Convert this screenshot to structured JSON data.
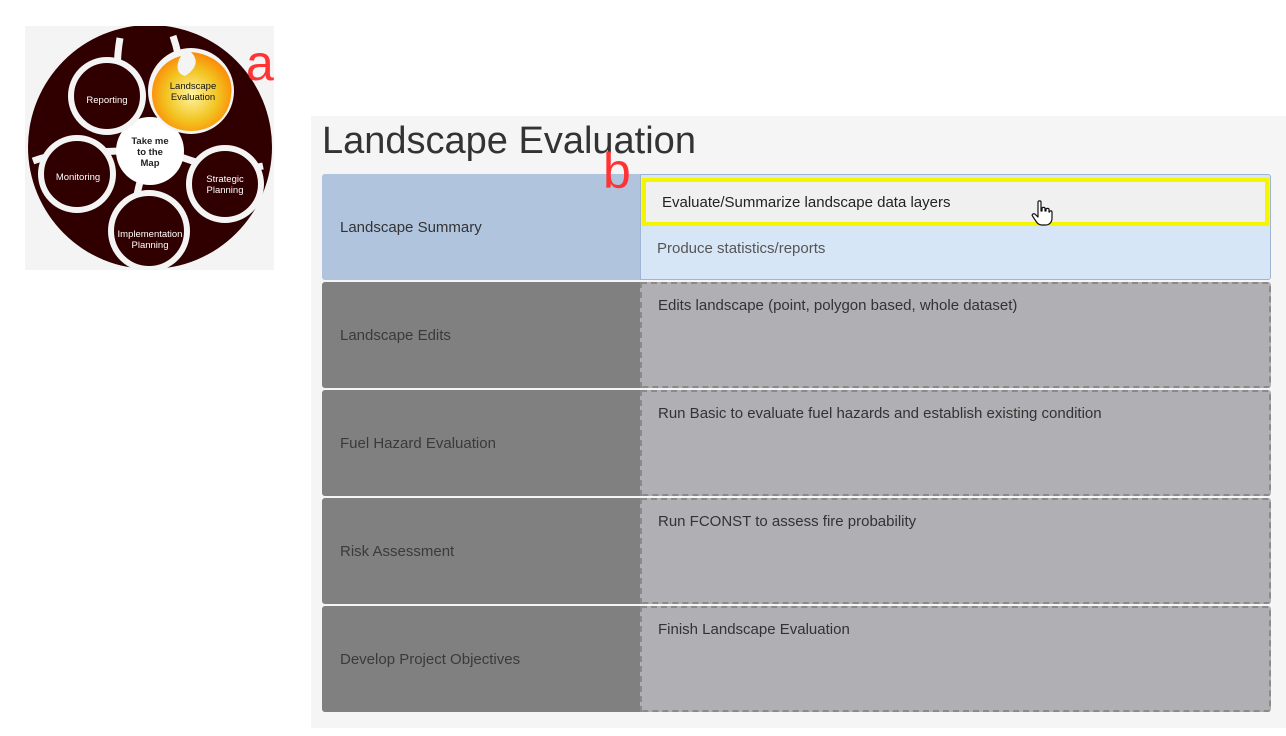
{
  "annotations": {
    "a": "a",
    "b": "b"
  },
  "wheel": {
    "center": "Take me\nto the\nMap",
    "segments": [
      {
        "id": "landscape-evaluation",
        "label": "Landscape\nEvaluation",
        "active": true
      },
      {
        "id": "strategic-planning",
        "label": "Strategic\nPlanning"
      },
      {
        "id": "implementation-planning",
        "label": "Implementation\nPlanning"
      },
      {
        "id": "monitoring",
        "label": "Monitoring"
      },
      {
        "id": "reporting",
        "label": "Reporting"
      }
    ],
    "colors": {
      "disc": "#300000",
      "active_fill": "#f2c320",
      "active_glow": "#ff8a00"
    }
  },
  "page": {
    "title": "Landscape Evaluation",
    "steps": [
      {
        "label": "Landscape Summary",
        "state": "active",
        "tasks": [
          "Evaluate/Summarize landscape data layers",
          "Produce statistics/reports"
        ]
      },
      {
        "label": "Landscape Edits",
        "state": "disabled",
        "tasks": [
          "Edits landscape (point, polygon based, whole dataset)"
        ]
      },
      {
        "label": "Fuel Hazard Evaluation",
        "state": "disabled",
        "tasks": [
          "Run Basic to evaluate fuel hazards and establish existing condition"
        ]
      },
      {
        "label": "Risk Assessment",
        "state": "disabled",
        "tasks": [
          "Run FCONST to assess fire probability"
        ]
      },
      {
        "label": "Develop Project Objectives",
        "state": "disabled",
        "tasks": [
          "Finish Landscape Evaluation"
        ]
      }
    ],
    "colors": {
      "active_left": "#b0c4de",
      "active_right": "#d7e6f6",
      "highlight_border": "#f5f500",
      "disabled_left": "#808080",
      "disabled_right": "#b0afb3"
    },
    "cursor": "hand-pointer-icon"
  }
}
